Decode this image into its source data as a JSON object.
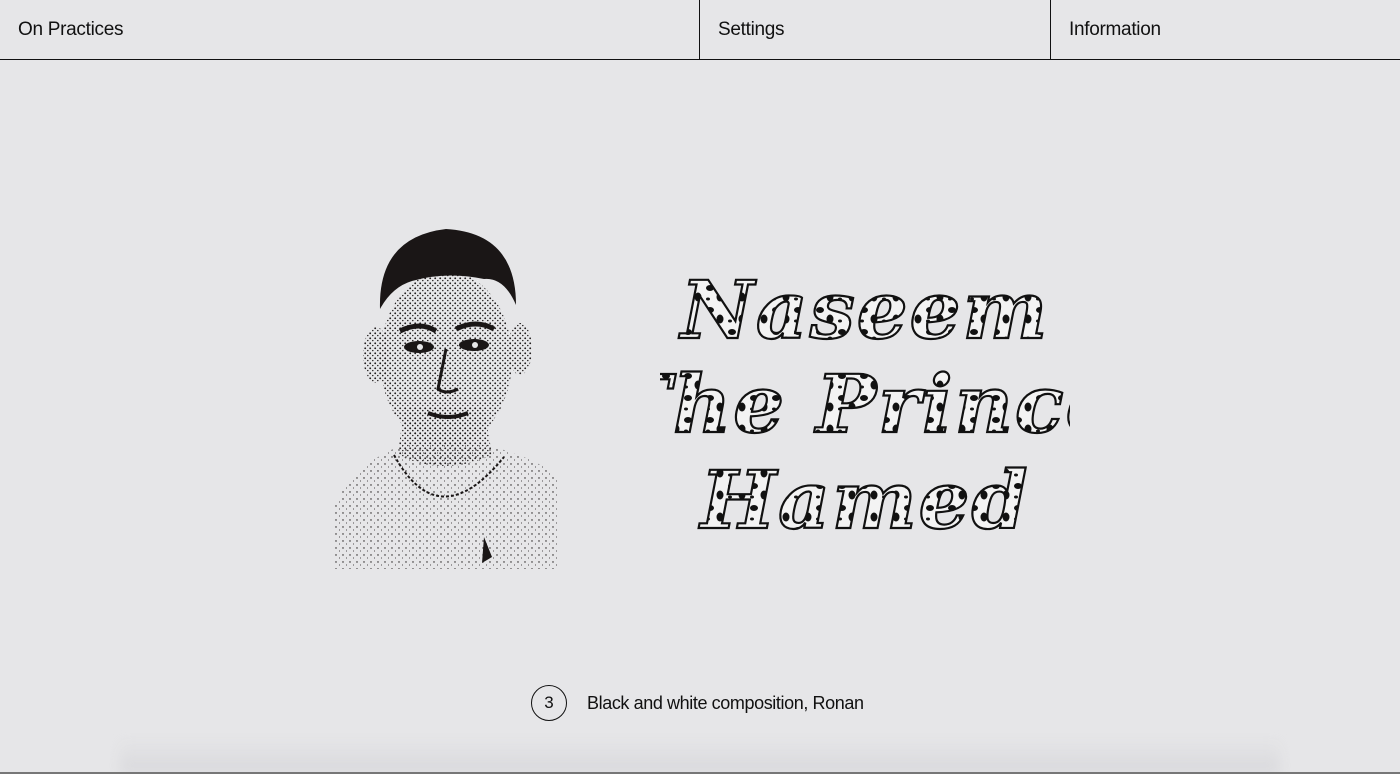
{
  "nav": {
    "home_label": "On Practices",
    "settings_label": "Settings",
    "info_label": "Information"
  },
  "artwork": {
    "title_lines": [
      "Naseem",
      "The Prince",
      "Hamed"
    ]
  },
  "caption": {
    "index": "3",
    "text": "Black and white composition, Ronan"
  },
  "colors": {
    "background": "#e6e6e8",
    "ink": "#111111"
  }
}
